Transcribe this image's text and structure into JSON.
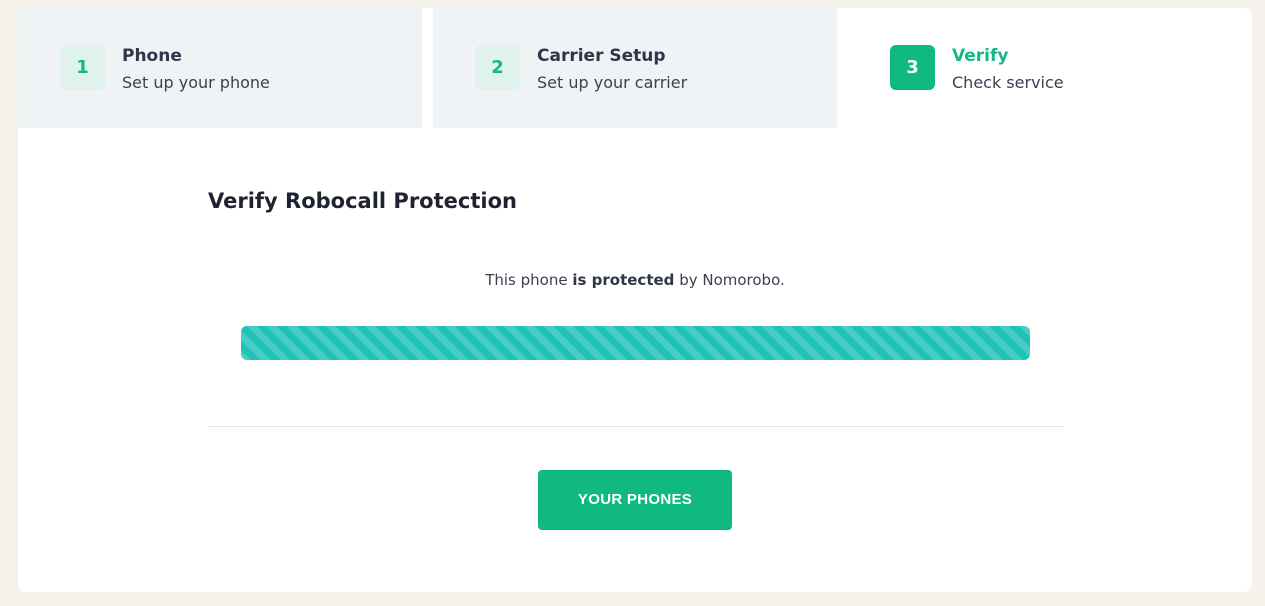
{
  "steps": [
    {
      "number": "1",
      "title": "Phone",
      "subtitle": "Set up your phone"
    },
    {
      "number": "2",
      "title": "Carrier Setup",
      "subtitle": "Set up your carrier"
    },
    {
      "number": "3",
      "title": "Verify",
      "subtitle": "Check service"
    }
  ],
  "main": {
    "heading": "Verify Robocall Protection",
    "status_prefix": "This phone ",
    "status_bold": "is protected",
    "status_suffix": " by Nomorobo."
  },
  "progress": {
    "value_percent": 100
  },
  "actions": {
    "your_phones_label": "YOUR PHONES"
  },
  "colors": {
    "accent": "#10b981",
    "progress_bar": "#20c2b8",
    "step_inactive_bg": "#eff3f6",
    "page_bg": "#f5f1eb"
  }
}
